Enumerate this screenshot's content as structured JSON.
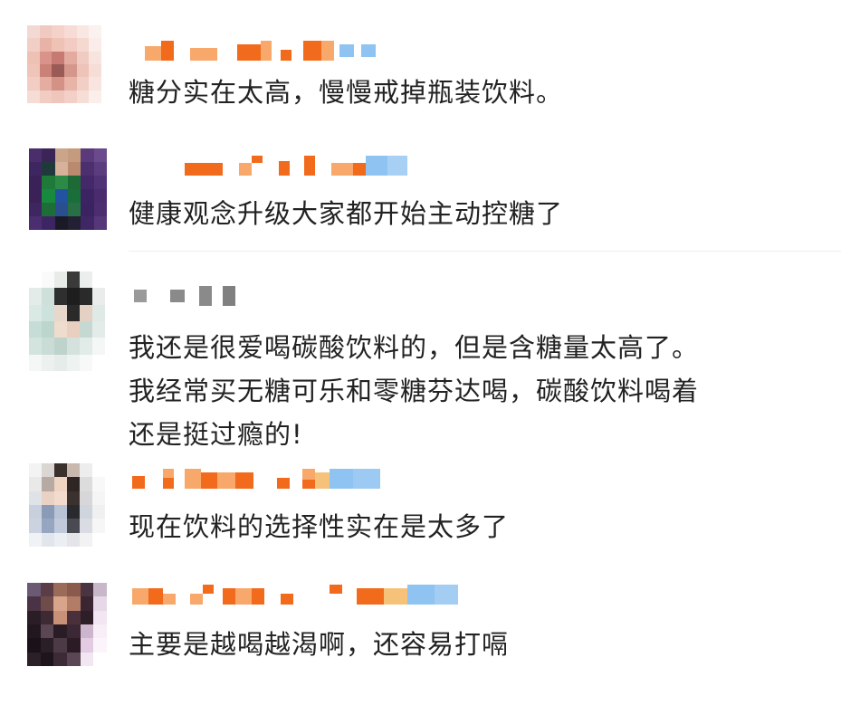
{
  "comments": [
    {
      "text_lines": [
        "糖分实在太高，慢慢戒掉瓶装饮料。"
      ]
    },
    {
      "text_lines": [
        "健康观念升级大家都开始主动控糖了"
      ]
    },
    {
      "text_lines": [
        "我还是很爱喝碳酸饮料的，但是含糖量太高了。",
        "我经常买无糖可乐和零糖芬达喝，碳酸饮料喝着",
        "还是挺过瘾的!"
      ]
    },
    {
      "text_lines": [
        "现在饮料的选择性实在是太多了"
      ]
    },
    {
      "text_lines": [
        "主要是越喝越渴啊，还容易打嗝"
      ]
    }
  ],
  "colors": {
    "text": "#222222",
    "username_orange": "#f26a1b",
    "username_light_orange": "#f7a86a",
    "username_blue": "#8fc4f2",
    "divider": "#efefef",
    "background": "#ffffff"
  }
}
